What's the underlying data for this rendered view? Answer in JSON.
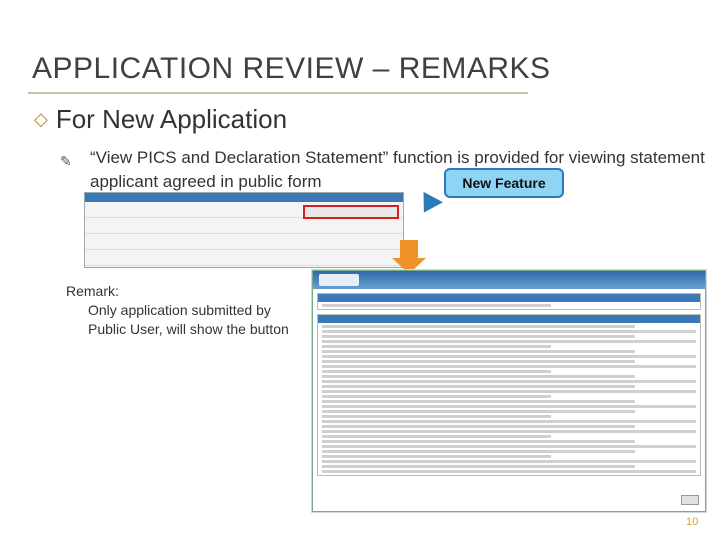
{
  "slide": {
    "title": "APPLICATION REVIEW – REMARKS",
    "bullet1": "For New Application",
    "bullet2": "“View PICS and Declaration Statement” function is provided for viewing statement applicant agreed in public form",
    "callout": "New Feature",
    "remark_title": "Remark:",
    "remark_line1": "Only application submitted by",
    "remark_line2": "Public User, will show the button",
    "page_number": "10"
  },
  "colors": {
    "title_text": "#404040",
    "callout_fill": "#8fd4f4",
    "callout_border": "#2a7ab8",
    "arrow": "#f0922a",
    "page_number": "#d4a23a",
    "highlight_border": "#d02020"
  },
  "icons": {
    "bullet1": "hollow-diamond",
    "bullet2": "pencil"
  }
}
